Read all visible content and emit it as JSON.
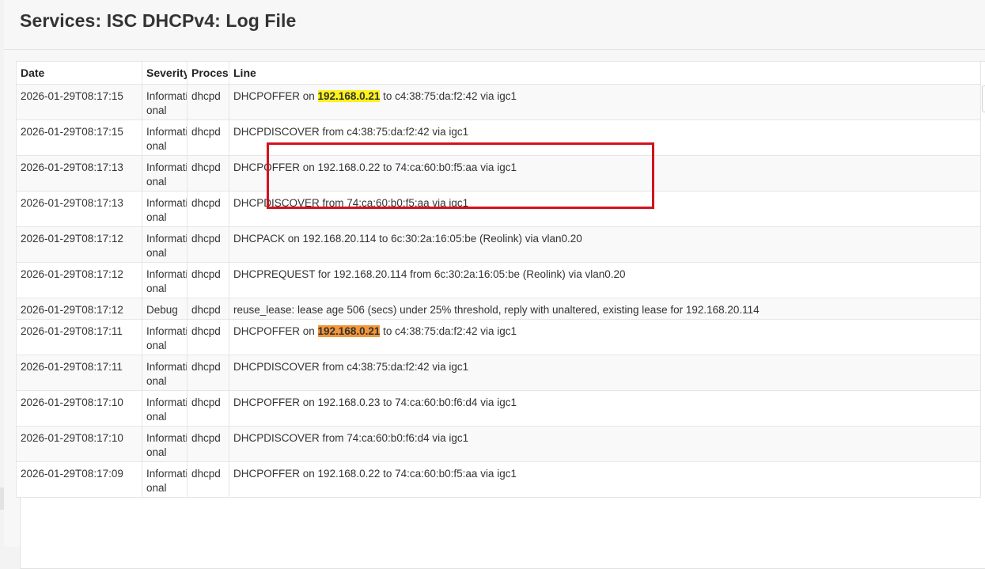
{
  "page": {
    "title": "Services: ISC DHCPv4: Log File"
  },
  "table": {
    "columns": [
      "Date",
      "Severity",
      "Process",
      "Line"
    ],
    "rows": [
      {
        "date": "2026-01-29T08:17:15",
        "severity": "Informati onal",
        "process": "dhcpd",
        "line_pre": "DHCPOFFER on ",
        "line_hl": "192.168.0.21",
        "line_post": " to c4:38:75:da:f2:42 via igc1",
        "highlight": "yellow"
      },
      {
        "date": "2026-01-29T08:17:15",
        "severity": "Informati onal",
        "process": "dhcpd",
        "line": "DHCPDISCOVER from c4:38:75:da:f2:42 via igc1"
      },
      {
        "date": "2026-01-29T08:17:13",
        "severity": "Informati onal",
        "process": "dhcpd",
        "line": "DHCPOFFER on 192.168.0.22 to 74:ca:60:b0:f5:aa via igc1"
      },
      {
        "date": "2026-01-29T08:17:13",
        "severity": "Informati onal",
        "process": "dhcpd",
        "line": "DHCPDISCOVER from 74:ca:60:b0:f5:aa via igc1"
      },
      {
        "date": "2026-01-29T08:17:12",
        "severity": "Informati onal",
        "process": "dhcpd",
        "line": "DHCPACK on 192.168.20.114 to 6c:30:2a:16:05:be (Reolink) via vlan0.20"
      },
      {
        "date": "2026-01-29T08:17:12",
        "severity": "Informati onal",
        "process": "dhcpd",
        "line": "DHCPREQUEST for 192.168.20.114 from 6c:30:2a:16:05:be (Reolink) via vlan0.20"
      },
      {
        "date": "2026-01-29T08:17:12",
        "severity": "Debug",
        "process": "dhcpd",
        "line": "reuse_lease: lease age 506 (secs) under 25% threshold, reply with unaltered, existing lease for 192.168.20.114"
      },
      {
        "date": "2026-01-29T08:17:11",
        "severity": "Informati onal",
        "process": "dhcpd",
        "line_pre": "DHCPOFFER on ",
        "line_hl": "192.168.0.21",
        "line_post": " to c4:38:75:da:f2:42 via igc1",
        "highlight": "orange"
      },
      {
        "date": "2026-01-29T08:17:11",
        "severity": "Informati onal",
        "process": "dhcpd",
        "line": "DHCPDISCOVER from c4:38:75:da:f2:42 via igc1"
      },
      {
        "date": "2026-01-29T08:17:10",
        "severity": "Informati onal",
        "process": "dhcpd",
        "line": "DHCPOFFER on 192.168.0.23 to 74:ca:60:b0:f6:d4 via igc1"
      },
      {
        "date": "2026-01-29T08:17:10",
        "severity": "Informati onal",
        "process": "dhcpd",
        "line": "DHCPDISCOVER from 74:ca:60:b0:f6:d4 via igc1"
      },
      {
        "date": "2026-01-29T08:17:09",
        "severity": "Informati onal",
        "process": "dhcpd",
        "line": "DHCPOFFER on 192.168.0.22 to 74:ca:60:b0:f5:aa via igc1"
      }
    ]
  },
  "colors": {
    "annotation_box": "#d4121d",
    "highlight_yellow": "#fff21a",
    "highlight_orange": "#f3963a"
  }
}
